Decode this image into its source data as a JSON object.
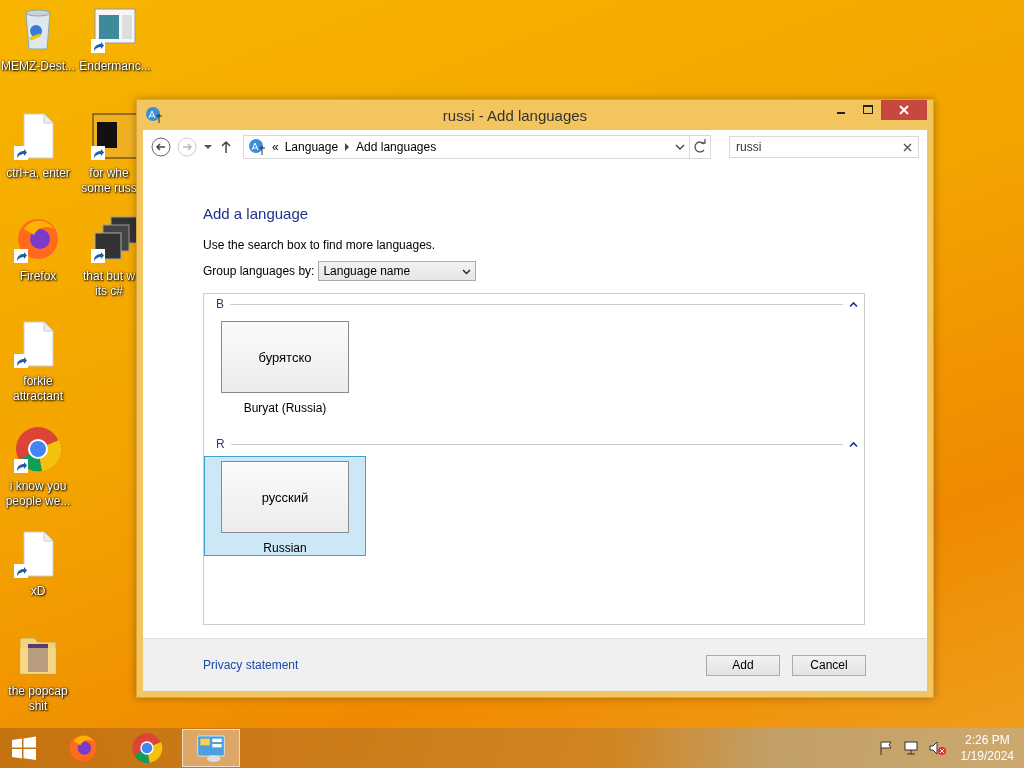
{
  "desktop_icons": [
    {
      "label": "MEMZ-Dest...",
      "kind": "recycle-bin",
      "shortcut": false
    },
    {
      "label": "Endermanc...",
      "kind": "window-app",
      "shortcut": true
    },
    {
      "label": "ctrl+a, enter",
      "kind": "document",
      "shortcut": true
    },
    {
      "label": "for whe some russ",
      "kind": "yellow-app",
      "shortcut": true
    },
    {
      "label": "Firefox",
      "kind": "firefox",
      "shortcut": true
    },
    {
      "label": "that but w its c#",
      "kind": "stack",
      "shortcut": true
    },
    {
      "label": "forkie attractant",
      "kind": "document",
      "shortcut": true
    },
    {
      "label": "i know you people we...",
      "kind": "chrome",
      "shortcut": true
    },
    {
      "label": "xD",
      "kind": "document",
      "shortcut": true
    },
    {
      "label": "the popcap shit",
      "kind": "folder",
      "shortcut": false
    }
  ],
  "window": {
    "title": "russi - Add languages",
    "address": {
      "overflow": "«",
      "crumbs": [
        "Language",
        "Add languages"
      ]
    },
    "search": {
      "value": "russi"
    },
    "heading": "Add a language",
    "hint": "Use the search box to find more languages.",
    "group_by": {
      "label": "Group languages by:",
      "value": "Language name"
    },
    "groups": [
      {
        "letter": "B",
        "expanded": true,
        "languages": [
          {
            "native": "бурятско",
            "name": "Buryat (Russia)",
            "selected": false
          }
        ]
      },
      {
        "letter": "R",
        "expanded": true,
        "languages": [
          {
            "native": "русский",
            "name": "Russian",
            "selected": true
          }
        ]
      }
    ],
    "privacy_link": "Privacy statement",
    "buttons": [
      "Add",
      "Cancel"
    ]
  },
  "taskbar": {
    "apps": [
      {
        "kind": "firefox",
        "active": false
      },
      {
        "kind": "chrome",
        "active": false
      },
      {
        "kind": "control-panel",
        "active": true
      }
    ],
    "time": "2:26 PM",
    "date": "1/19/2024"
  }
}
